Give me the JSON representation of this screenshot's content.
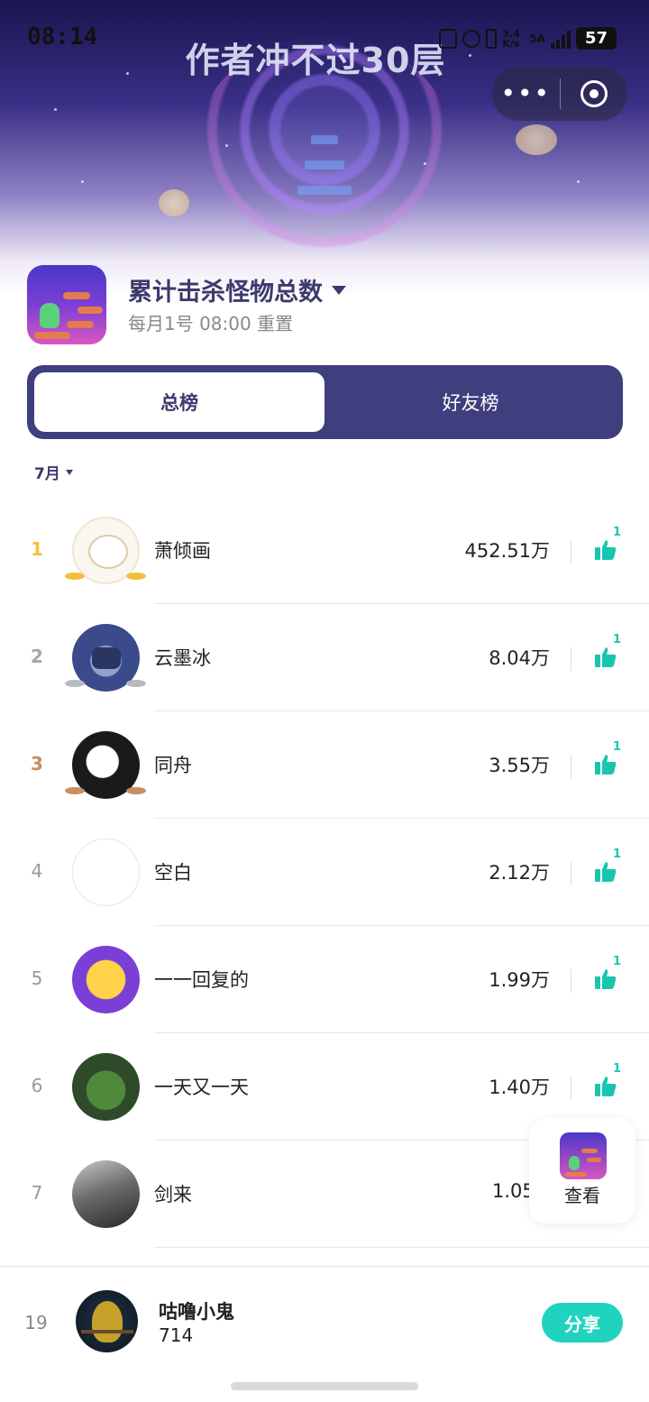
{
  "status_bar": {
    "time": "08:14",
    "speed": "3.4 K/s",
    "network": "5A",
    "battery": "57"
  },
  "hero": {
    "game_title": "作者冲不过30层"
  },
  "board": {
    "title": "累计击杀怪物总数",
    "reset_note": "每月1号 08:00 重置"
  },
  "tabs": [
    {
      "label": "总榜",
      "active": true
    },
    {
      "label": "好友榜",
      "active": false
    }
  ],
  "month_filter": "7月",
  "rows": [
    {
      "rank": "1",
      "name": "萧倾画",
      "score": "452.51万",
      "likes": "1"
    },
    {
      "rank": "2",
      "name": "云墨冰",
      "score": "8.04万",
      "likes": "1"
    },
    {
      "rank": "3",
      "name": "同舟",
      "score": "3.55万",
      "likes": "1"
    },
    {
      "rank": "4",
      "name": "空白",
      "score": "2.12万",
      "likes": "1"
    },
    {
      "rank": "5",
      "name": "一一回复的",
      "score": "1.99万",
      "likes": "1"
    },
    {
      "rank": "6",
      "name": "一天又一天",
      "score": "1.40万",
      "likes": "1"
    },
    {
      "rank": "7",
      "name": "剑来",
      "score": "1.05",
      "likes": ""
    }
  ],
  "float_button": {
    "label": "查看"
  },
  "me": {
    "rank": "19",
    "name": "咕噜小鬼",
    "score": "714",
    "share_label": "分享"
  },
  "colors": {
    "accent": "#1fd3bf",
    "tab_bg": "#3f3e7e",
    "title": "#3d3a6e",
    "like": "#18c6b0"
  }
}
